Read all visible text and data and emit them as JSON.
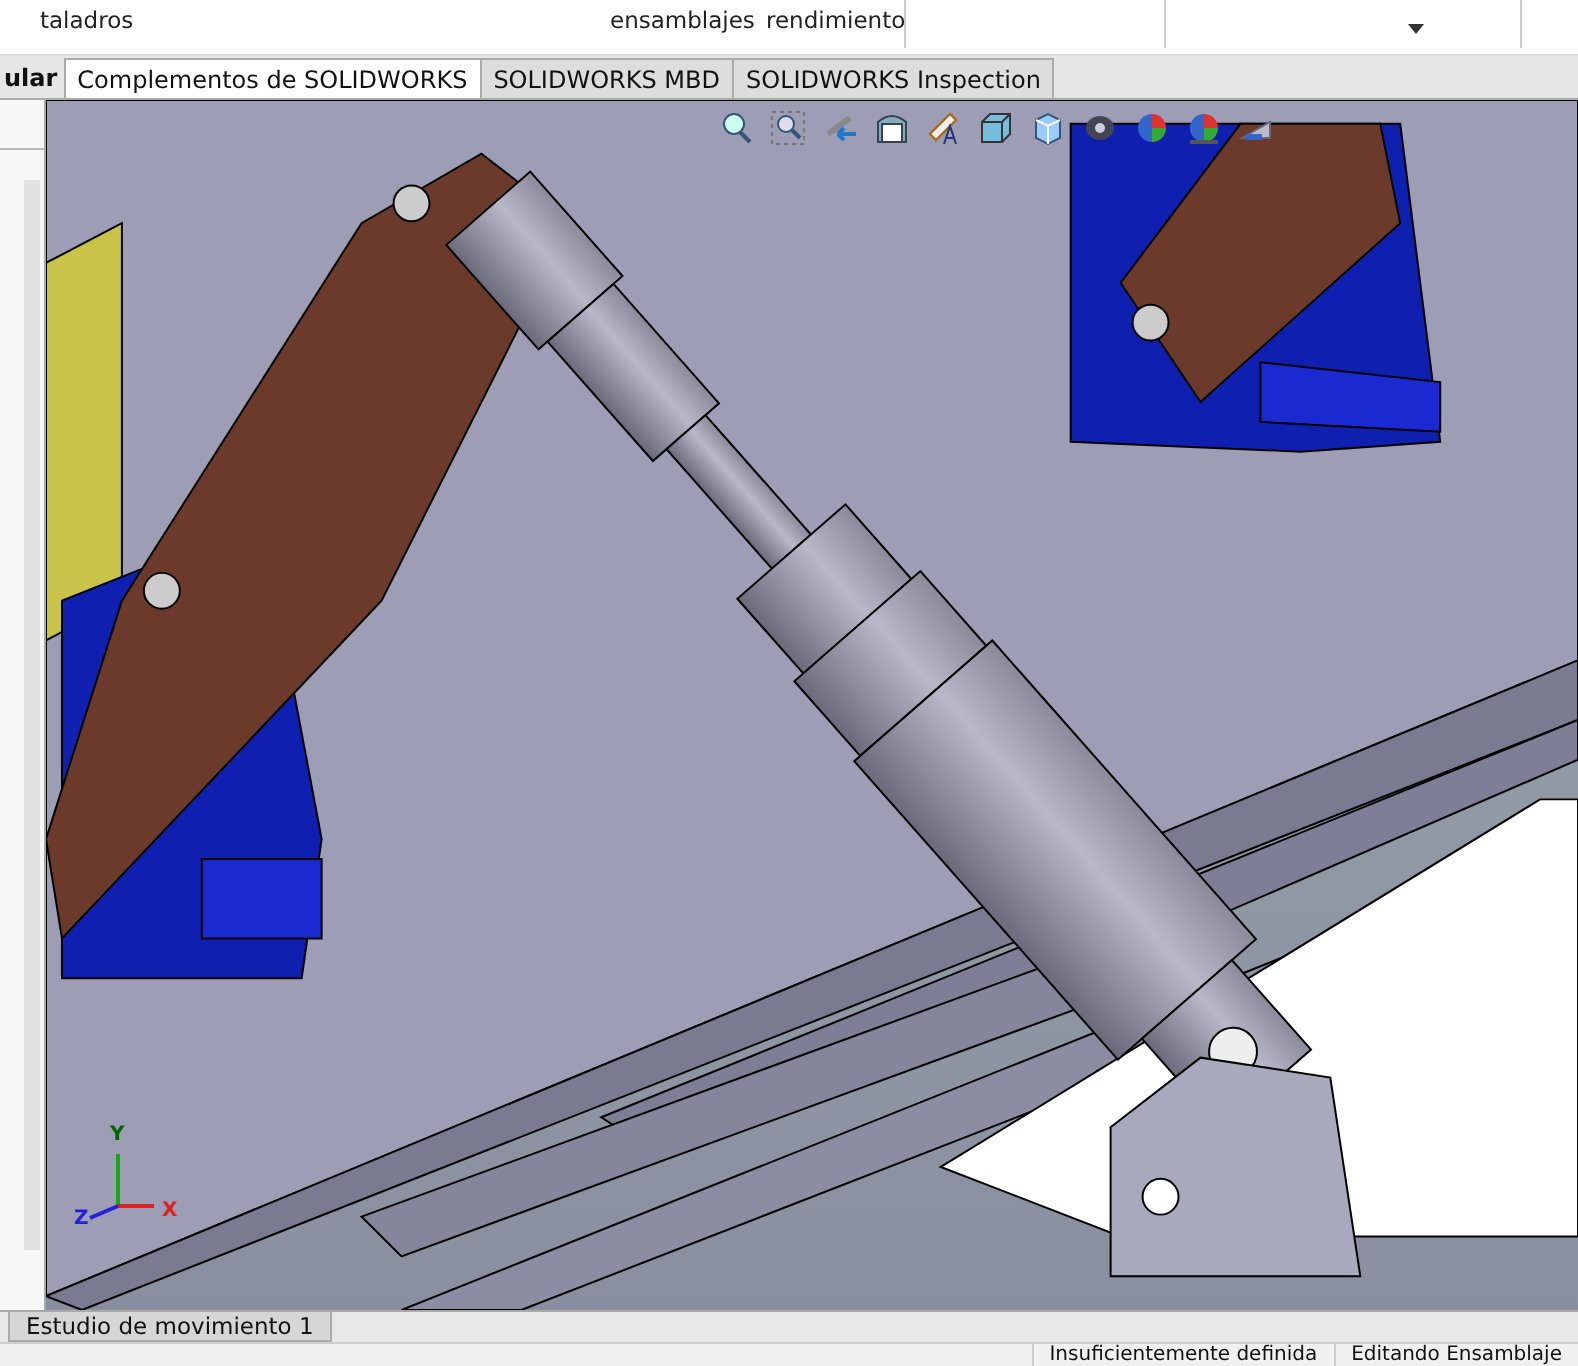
{
  "ribbon": {
    "labels": [
      "taladros",
      "ensamblajes",
      "rendimiento"
    ]
  },
  "tabs": [
    {
      "label": "ular",
      "selected": false
    },
    {
      "label": "Complementos de SOLIDWORKS",
      "selected": true
    },
    {
      "label": "SOLIDWORKS MBD",
      "selected": false
    },
    {
      "label": "SOLIDWORKS Inspection",
      "selected": false
    }
  ],
  "triad": {
    "x": "X",
    "y": "Y",
    "z": "Z"
  },
  "bottom_tabs": [
    {
      "label": "Estudio de movimiento 1",
      "selected": true
    }
  ],
  "status_bar": [
    "Insuficientemente definida",
    "Editando Ensamblaje"
  ]
}
